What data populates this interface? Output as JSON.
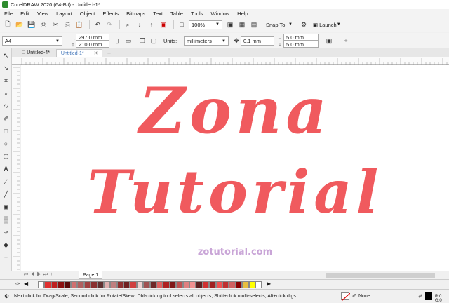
{
  "title_bar": {
    "title": "CorelDRAW 2020 (64-Bit) - Untitled-1*"
  },
  "menu": [
    "File",
    "Edit",
    "View",
    "Layout",
    "Object",
    "Effects",
    "Bitmaps",
    "Text",
    "Table",
    "Tools",
    "Window",
    "Help"
  ],
  "toolbar": {
    "zoom": "100%",
    "snap_to": "Snap To",
    "launch": "Launch"
  },
  "property_bar": {
    "page_size": "A4",
    "width": "297.0 mm",
    "height": "210.0 mm",
    "units_label": "Units:",
    "units_value": "millimeters",
    "nudge": "0.1 mm",
    "dup_x": "5.0 mm",
    "dup_y": "5.0 mm"
  },
  "tabs": [
    {
      "label": "Untitled-4*",
      "active": false
    },
    {
      "label": "Untitled-1*",
      "active": true
    }
  ],
  "canvas": {
    "line1": "Zona",
    "line2": "Tutorial",
    "watermark": "zotutorial.com",
    "text_color": "#f05a5e"
  },
  "page_nav": {
    "page_label": "Page 1"
  },
  "palette": [
    "#ffffff",
    "#e03030",
    "#c02020",
    "#8b1010",
    "#5a0a0a",
    "#d07070",
    "#b06060",
    "#a04040",
    "#8a3030",
    "#603030",
    "#e0b0b0",
    "#c08080",
    "#903030",
    "#702020",
    "#d04040",
    "#f0d0d0",
    "#a05050",
    "#702828",
    "#e06060",
    "#b02020",
    "#801818",
    "#c05050",
    "#e08080",
    "#f09090",
    "#602020",
    "#d03030",
    "#a02020",
    "#f05050",
    "#c03030",
    "#d06060",
    "#8b0000",
    "#e8c040",
    "#ffff00",
    "#ffffff"
  ],
  "status": {
    "hint": "Next click for Drag/Scale; Second click for Rotate/Skew; Dbl-clicking tool selects all objects; Shift+click multi-selects; Alt+click digs",
    "fill": "None",
    "rgb": "R:0 G:0"
  }
}
